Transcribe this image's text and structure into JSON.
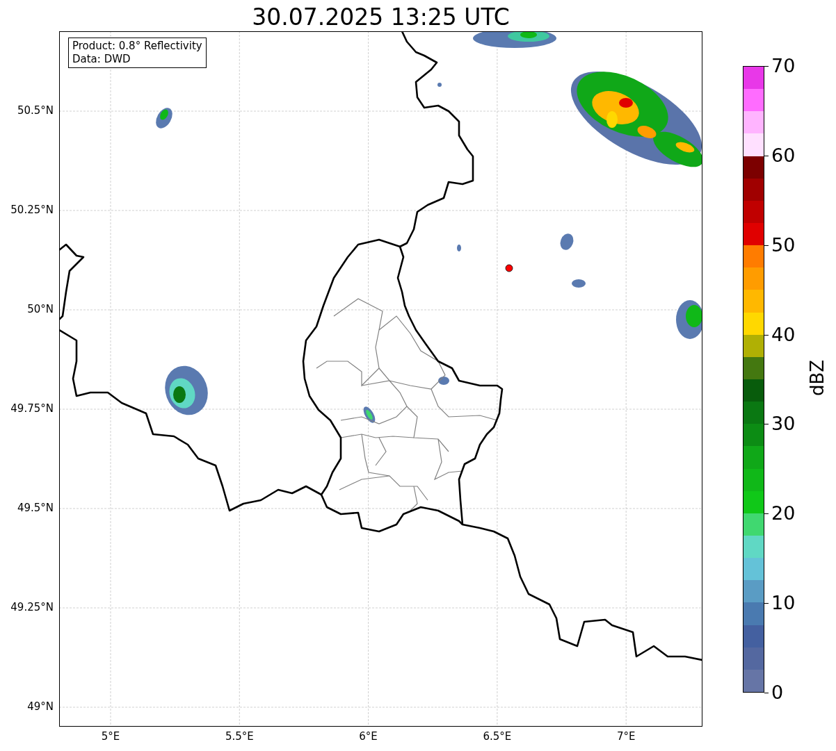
{
  "title": "30.07.2025 13:25 UTC",
  "map": {
    "info_lines": [
      "Product: 0.8° Reflectivity",
      "Data: DWD"
    ],
    "lat_labels": [
      "50.5°N",
      "50.25°N",
      "50°N",
      "49.75°N",
      "49.5°N",
      "49.25°N",
      "49°N"
    ],
    "lon_labels": [
      "5°E",
      "5.5°E",
      "6°E",
      "6.5°E",
      "7°E"
    ]
  },
  "colorbar": {
    "label": "dBZ",
    "ticks": [
      "70",
      "60",
      "50",
      "40",
      "30",
      "20",
      "10",
      "0"
    ],
    "segments": [
      {
        "color": "#6675a6"
      },
      {
        "color": "#5468a0"
      },
      {
        "color": "#4460a0"
      },
      {
        "color": "#4a7ab0"
      },
      {
        "color": "#5a9cc4"
      },
      {
        "color": "#64c2d8"
      },
      {
        "color": "#60d8c4"
      },
      {
        "color": "#40d870"
      },
      {
        "color": "#10c818"
      },
      {
        "color": "#10b818"
      },
      {
        "color": "#10a818"
      },
      {
        "color": "#0c8c14"
      },
      {
        "color": "#0a7812"
      },
      {
        "color": "#085c0c"
      },
      {
        "color": "#447810"
      },
      {
        "color": "#b0b004"
      },
      {
        "color": "#ffd800"
      },
      {
        "color": "#ffb800"
      },
      {
        "color": "#ff9c00"
      },
      {
        "color": "#ff7c00"
      },
      {
        "color": "#e00000"
      },
      {
        "color": "#c00000"
      },
      {
        "color": "#a00000"
      },
      {
        "color": "#7c0000"
      },
      {
        "color": "#ffe0ff"
      },
      {
        "color": "#ffb4ff"
      },
      {
        "color": "#ff6cff"
      },
      {
        "color": "#e838e8"
      }
    ]
  }
}
